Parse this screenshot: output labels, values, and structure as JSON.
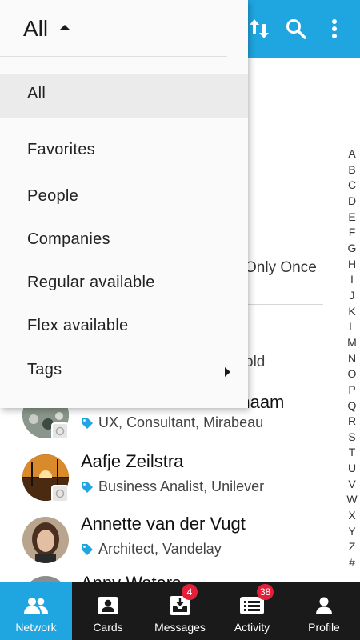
{
  "filter_dropdown": {
    "current": "All",
    "items": [
      {
        "label": "All",
        "selected": true
      },
      {
        "label": "Favorites"
      },
      {
        "label": "People"
      },
      {
        "label": "Companies"
      },
      {
        "label": "Regular available"
      },
      {
        "label": "Flex available"
      },
      {
        "label": "Tags",
        "has_submenu": true
      }
    ]
  },
  "toolbar": {
    "actions": [
      "sort-icon",
      "search-icon",
      "more-vert-icon"
    ]
  },
  "background": {
    "partial_text_1": "Only Once",
    "partial_text_2": "old"
  },
  "contacts": [
    {
      "name": "Andre van de Achternaam",
      "tags": "UX, Consultant, Mirabeau"
    },
    {
      "name": "Aafje Zeilstra",
      "tags": "Business Analist, Unilever"
    },
    {
      "name": "Annette van der Vugt",
      "tags": "Architect, Vandelay"
    },
    {
      "name": "Anny Waters",
      "tags": ""
    }
  ],
  "alphabet_index": [
    "A",
    "B",
    "C",
    "D",
    "E",
    "F",
    "G",
    "H",
    "I",
    "J",
    "K",
    "L",
    "M",
    "N",
    "O",
    "P",
    "Q",
    "R",
    "S",
    "T",
    "U",
    "V",
    "W",
    "X",
    "Y",
    "Z",
    "#"
  ],
  "bottom_nav": [
    {
      "label": "Network",
      "icon": "people-icon",
      "active": true
    },
    {
      "label": "Cards",
      "icon": "contact-card-icon"
    },
    {
      "label": "Messages",
      "icon": "inbox-icon",
      "badge": "4"
    },
    {
      "label": "Activity",
      "icon": "activity-list-icon",
      "badge": "38"
    },
    {
      "label": "Profile",
      "icon": "person-icon"
    }
  ],
  "colors": {
    "accent": "#1fa6e0",
    "nav_background": "#1a1a1a",
    "badge": "#e3203a"
  }
}
